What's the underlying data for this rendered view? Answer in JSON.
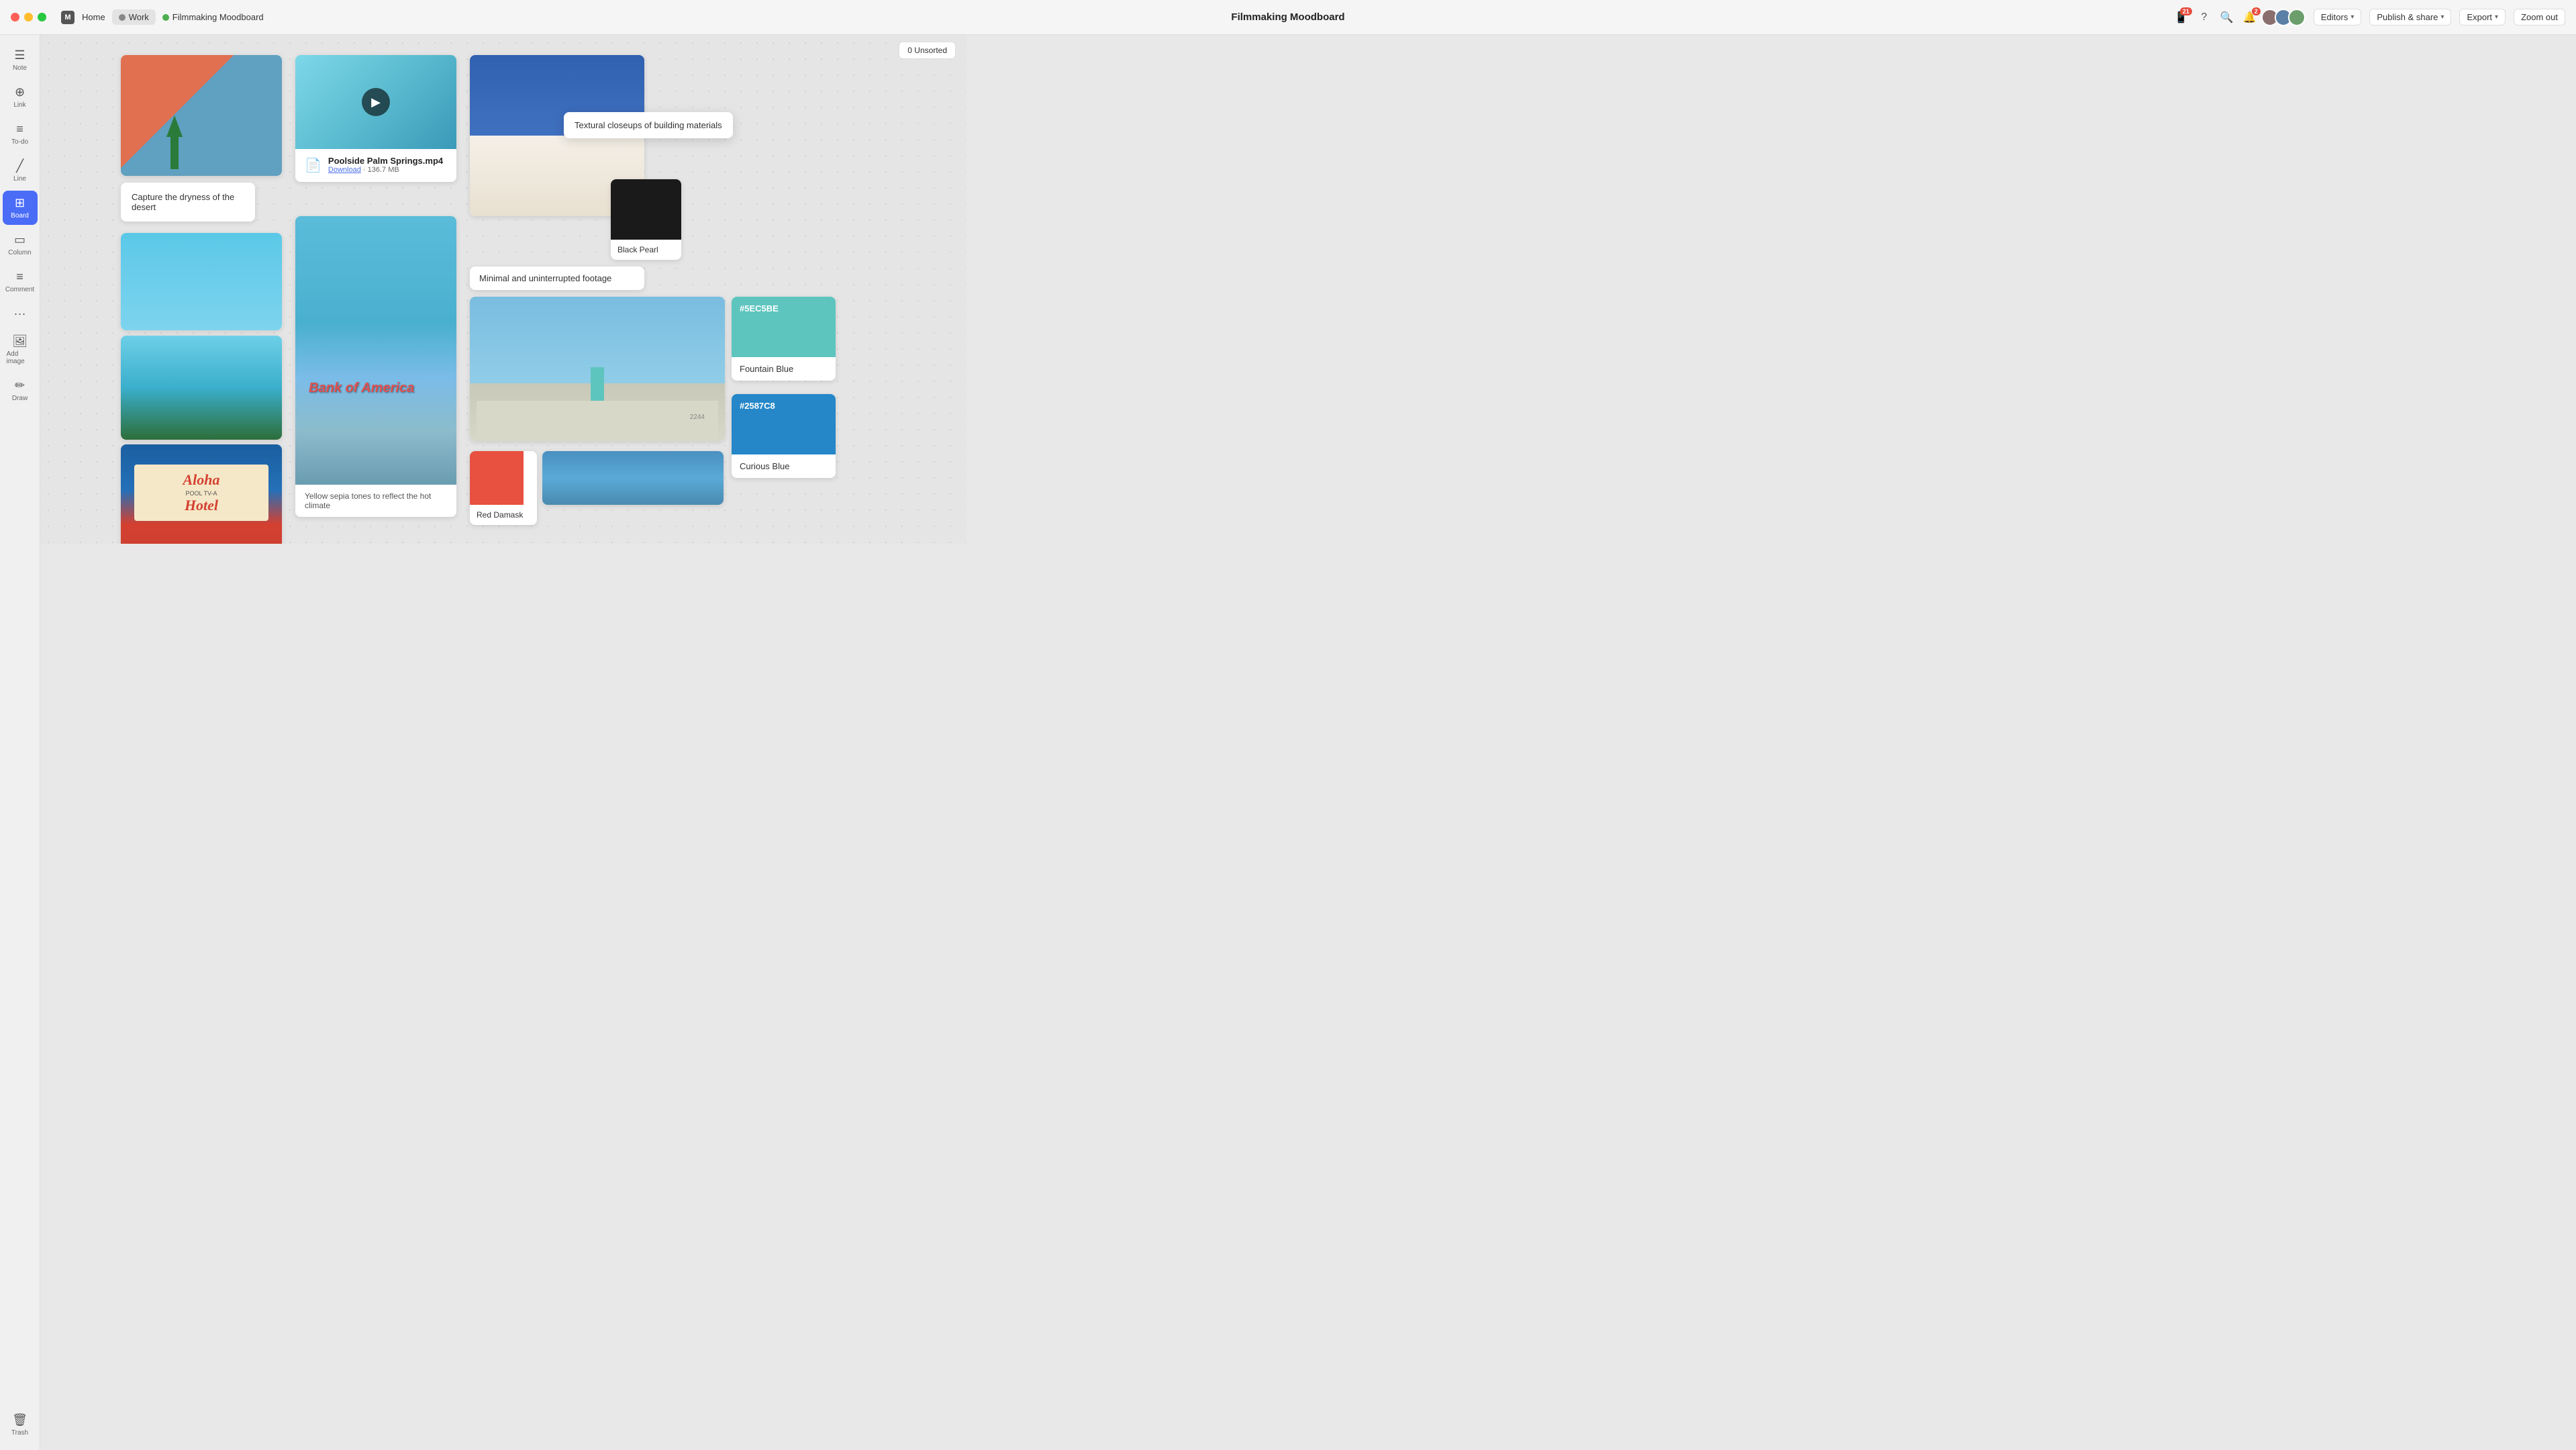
{
  "titlebar": {
    "traffic_lights": [
      "red",
      "yellow",
      "green"
    ],
    "tabs": [
      {
        "id": "home",
        "label": "Home",
        "active": false
      },
      {
        "id": "work",
        "label": "Work",
        "active": false
      },
      {
        "id": "moodboard",
        "label": "Filmmaking Moodboard",
        "active": true
      }
    ],
    "center_title": "Filmmaking Moodboard",
    "notification_count": "21",
    "bell_count": "2",
    "editors_label": "Editors",
    "publish_label": "Publish & share",
    "export_label": "Export",
    "zoom_label": "Zoom out"
  },
  "sidebar": {
    "items": [
      {
        "id": "note",
        "icon": "☰",
        "label": "Note"
      },
      {
        "id": "link",
        "icon": "🔗",
        "label": "Link"
      },
      {
        "id": "todo",
        "icon": "≡",
        "label": "To-do"
      },
      {
        "id": "line",
        "icon": "╱",
        "label": "Line"
      },
      {
        "id": "board",
        "icon": "⊞",
        "label": "Board"
      },
      {
        "id": "column",
        "icon": "▭",
        "label": "Column"
      },
      {
        "id": "comment",
        "icon": "≡",
        "label": "Comment"
      },
      {
        "id": "more",
        "icon": "•••",
        "label": ""
      },
      {
        "id": "add-image",
        "icon": "🖼",
        "label": "Add image"
      },
      {
        "id": "draw",
        "icon": "✏",
        "label": "Draw"
      }
    ],
    "trash": {
      "label": "Trash",
      "icon": "🗑"
    }
  },
  "canvas": {
    "unsorted_label": "0 Unsorted"
  },
  "cards": {
    "coral_wall_caption": "Capture the dryness of the desert",
    "video_title": "Poolside Palm Springs.mp4",
    "video_download_label": "Download",
    "video_size": "136.7 MB",
    "architecture_tooltip": "Textural closeups of building materials",
    "black_pearl_label": "Black Pearl",
    "minimal_label": "Minimal and uninterrupted footage",
    "yellow_sepia_caption": "Yellow sepia tones to reflect the hot climate",
    "fountain_blue_hex": "#5EC5BE",
    "fountain_blue_name": "Fountain Blue",
    "curious_blue_hex": "#2587C8",
    "curious_blue_name": "Curious Blue",
    "red_damask_name": "Red Damask"
  }
}
